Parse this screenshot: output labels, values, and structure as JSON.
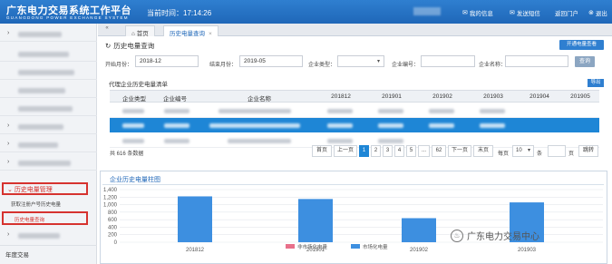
{
  "header": {
    "title_cn": "广东电力交易系统工作平台",
    "title_en": "GUANGDONG POWER EXCHANGE SYSTEM",
    "current_time_label": "当前时间：17:14:26",
    "links": [
      {
        "icon": "mail-icon",
        "label": "我的信息"
      },
      {
        "icon": "message-icon",
        "label": "发送短信"
      },
      {
        "icon": "portal-icon",
        "label": "返回门户"
      },
      {
        "icon": "logout-icon",
        "label": "退出"
      }
    ]
  },
  "sidebar": {
    "power_mgmt": "历史电量管理",
    "sub_items": [
      "获取注册户号历史电量",
      "历史电量查询"
    ],
    "year_trade": "年度交易"
  },
  "tabs": {
    "home": "首页",
    "active": "历史电量查询",
    "close": "×"
  },
  "page": {
    "title": "历史电量查询",
    "open_button": "开通电量查看"
  },
  "filters": {
    "start_label": "开始月份：",
    "start_value": "2018-12",
    "end_label": "结束月份：",
    "end_value": "2019-05",
    "type_label": "企业类型：",
    "number_label": "企业编号：",
    "name_label": "企业名称：",
    "query_button": "查询"
  },
  "table": {
    "title": "代理企业历史电量清单",
    "export_button": "导出",
    "columns": [
      "企业类型",
      "企业编号",
      "企业名称",
      "201812",
      "201901",
      "201902",
      "201903",
      "201904",
      "201905"
    ]
  },
  "pagination": {
    "total": "共 616 条数据",
    "first": "首页",
    "prev": "上一页",
    "pages": [
      "1",
      "2",
      "3",
      "4",
      "5",
      "...",
      "62"
    ],
    "next": "下一页",
    "last": "末页",
    "per_page_label": "每页",
    "per_page_value": "10",
    "per_page_unit": "条",
    "page_unit": "页",
    "go_button": "跳转"
  },
  "chart_data": {
    "type": "bar",
    "title": "企业历史电量柱图",
    "categories": [
      "201812",
      "201901",
      "201902",
      "201903"
    ],
    "series": [
      {
        "name": "非市场化电量",
        "values": [
          null,
          null,
          null,
          null
        ]
      },
      {
        "name": "市场化电量",
        "values": [
          1220,
          1150,
          640,
          1060
        ]
      }
    ],
    "yticks": [
      "1,400",
      "1,200",
      "1,000",
      "800",
      "600",
      "400",
      "200",
      "0"
    ],
    "ylim": [
      0,
      1400
    ],
    "colors": {
      "non_market": "#e8708a",
      "market": "#3d8fe0"
    }
  },
  "watermark": {
    "text": "广东电力交易中心"
  }
}
